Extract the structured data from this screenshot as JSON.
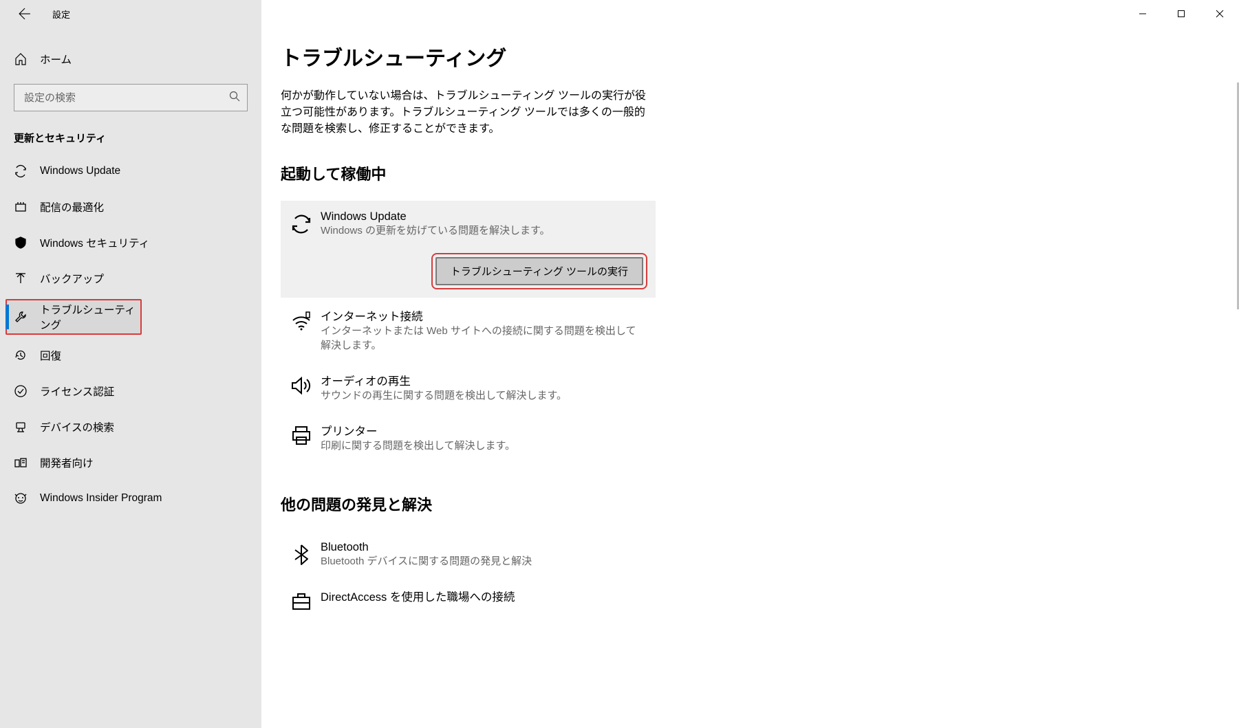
{
  "window": {
    "title": "設定"
  },
  "sidebar": {
    "home": "ホーム",
    "search_placeholder": "設定の検索",
    "category": "更新とセキュリティ",
    "items": [
      {
        "id": "windows-update",
        "label": "Windows Update",
        "icon": "sync-icon"
      },
      {
        "id": "delivery-opt",
        "label": "配信の最適化",
        "icon": "delivery-icon"
      },
      {
        "id": "windows-security",
        "label": "Windows セキュリティ",
        "icon": "shield-icon"
      },
      {
        "id": "backup",
        "label": "バックアップ",
        "icon": "arrow-up-icon"
      },
      {
        "id": "troubleshoot",
        "label": "トラブルシューティング",
        "icon": "wrench-icon",
        "active": true,
        "highlighted": true
      },
      {
        "id": "recovery",
        "label": "回復",
        "icon": "history-icon"
      },
      {
        "id": "activation",
        "label": "ライセンス認証",
        "icon": "check-circle-icon"
      },
      {
        "id": "find-device",
        "label": "デバイスの検索",
        "icon": "location-icon"
      },
      {
        "id": "developer",
        "label": "開発者向け",
        "icon": "code-icon"
      },
      {
        "id": "insider",
        "label": "Windows Insider Program",
        "icon": "insider-icon"
      }
    ]
  },
  "main": {
    "title": "トラブルシューティング",
    "description": "何かが動作していない場合は、トラブルシューティング ツールの実行が役立つ可能性があります。トラブルシューティング ツールでは多くの一般的な問題を検索し、修正することができます。",
    "section_running": "起動して稼働中",
    "section_other": "他の問題の発見と解決",
    "run_button": "トラブルシューティング ツールの実行",
    "items_running": [
      {
        "title": "Windows Update",
        "desc": "Windows の更新を妨げている問題を解決します。",
        "icon": "sync-large-icon",
        "expanded": true
      },
      {
        "title": "インターネット接続",
        "desc": "インターネットまたは Web サイトへの接続に関する問題を検出して解決します。",
        "icon": "wifi-icon"
      },
      {
        "title": "オーディオの再生",
        "desc": "サウンドの再生に関する問題を検出して解決します。",
        "icon": "sound-icon"
      },
      {
        "title": "プリンター",
        "desc": "印刷に関する問題を検出して解決します。",
        "icon": "printer-icon"
      }
    ],
    "items_other": [
      {
        "title": "Bluetooth",
        "desc": "Bluetooth デバイスに関する問題の発見と解決",
        "icon": "bluetooth-icon"
      },
      {
        "title": "DirectAccess を使用した職場への接続",
        "desc": "",
        "icon": "briefcase-icon"
      }
    ]
  }
}
